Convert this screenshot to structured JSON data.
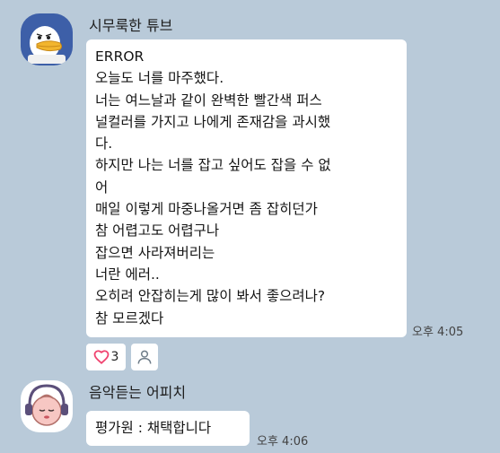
{
  "messages": [
    {
      "sender": "시무룩한 튜브",
      "avatar_icon": "sad-duck-avatar-icon",
      "lines": [
        "ERROR",
        "오늘도 너를 마주했다.",
        "너는 여느날과 같이 완벽한 빨간색 퍼스",
        "널컬러를 가지고 나에게 존재감을 과시했",
        "다.",
        "하지만 나는 너를 잡고 싶어도 잡을 수 없",
        "어",
        "매일 이렇게 마중나올거면 좀 잡히던가",
        "참 어렵고도 어렵구나",
        "잡으면 사라져버리는",
        "너란 에러..",
        "오히려 안잡히는게 많이 봐서 좋으려나?",
        "참 모르겠다"
      ],
      "time": "오후 4:05",
      "reactions": {
        "heart_icon": "heart-icon",
        "heart_count": "3",
        "person_icon": "person-icon"
      }
    },
    {
      "sender": "음악듣는 어피치",
      "avatar_icon": "apeach-headphones-avatar-icon",
      "text": "평가원 : 채택합니다",
      "time": "오후 4:06"
    }
  ],
  "colors": {
    "background": "#b9cad9",
    "bubble": "#ffffff",
    "heart": "#f0436f"
  }
}
